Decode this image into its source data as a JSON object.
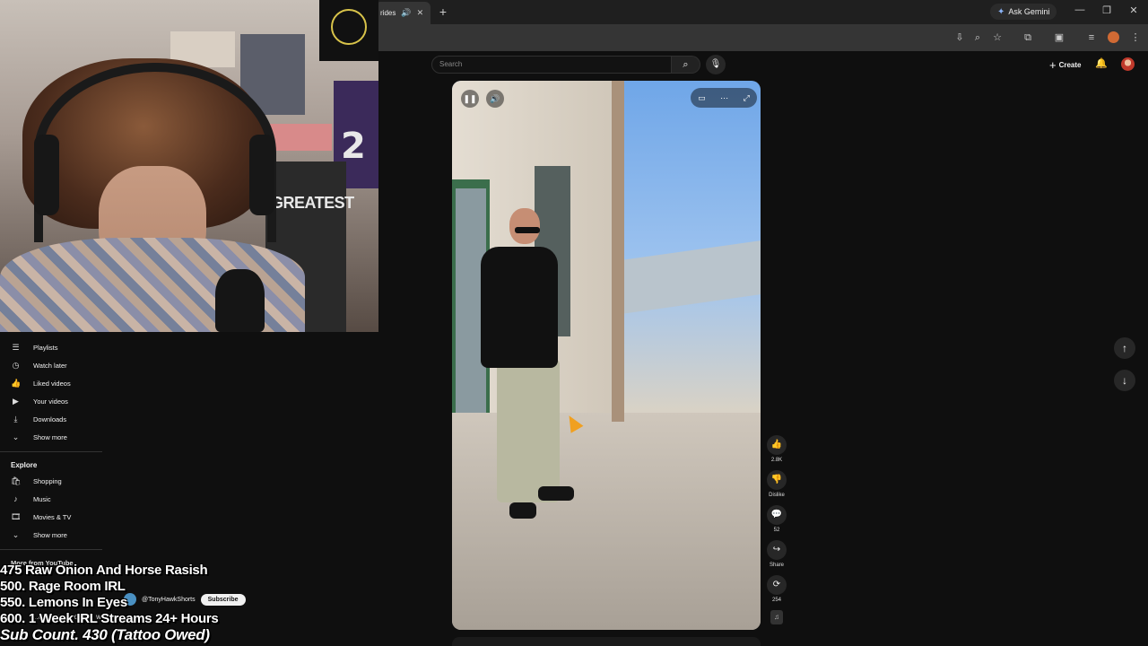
{
  "browser": {
    "tab_title": "rides",
    "ask_gemini": "Ask Gemini",
    "new_tab": "+",
    "minimize": "—",
    "restore": "❐",
    "close": "✕"
  },
  "youtube_header": {
    "search_placeholder": "Search",
    "create_label": "Create"
  },
  "sidebar": {
    "items": [
      {
        "label": "Playlists",
        "icon": "playlist-icon"
      },
      {
        "label": "Watch later",
        "icon": "clock-icon"
      },
      {
        "label": "Liked videos",
        "icon": "thumbs-up-icon"
      },
      {
        "label": "Your videos",
        "icon": "video-icon"
      },
      {
        "label": "Downloads",
        "icon": "download-icon"
      },
      {
        "label": "Show more",
        "icon": "chevron-down-icon"
      }
    ],
    "explore_heading": "Explore",
    "explore_items": [
      {
        "label": "Shopping",
        "icon": "bag-icon"
      },
      {
        "label": "Music",
        "icon": "music-icon"
      },
      {
        "label": "Movies & TV",
        "icon": "film-icon"
      },
      {
        "label": "Show more",
        "icon": "chevron-down-icon"
      }
    ],
    "more_heading": "More from YouTube"
  },
  "short": {
    "channel_handle": "@TonyHawkShorts",
    "subscribe_label": "Subscribe",
    "description": "...and proceeded to we...",
    "likes": "2.8K",
    "dislike_label": "Dislike",
    "comments": "52",
    "share_label": "Share",
    "remix_count": "254"
  },
  "stream_overlay": {
    "goals": [
      "475 Raw Onion And Horse Rasish",
      "500. Rage Room IRL",
      "550. Lemons In Eyes",
      "600. 1 Week IRL Streams 24+ Hours"
    ],
    "sub_count": "Sub Count. 430 (Tattoo Owed)"
  },
  "webcam": {
    "jersey_number": "2",
    "poster_text": "GREATEST"
  },
  "colors": {
    "page_bg": "#0f0f0f",
    "browser_chrome": "#1f1f1f",
    "cursor": "#f0a020",
    "gemini_accent": "#8ab4f8"
  }
}
